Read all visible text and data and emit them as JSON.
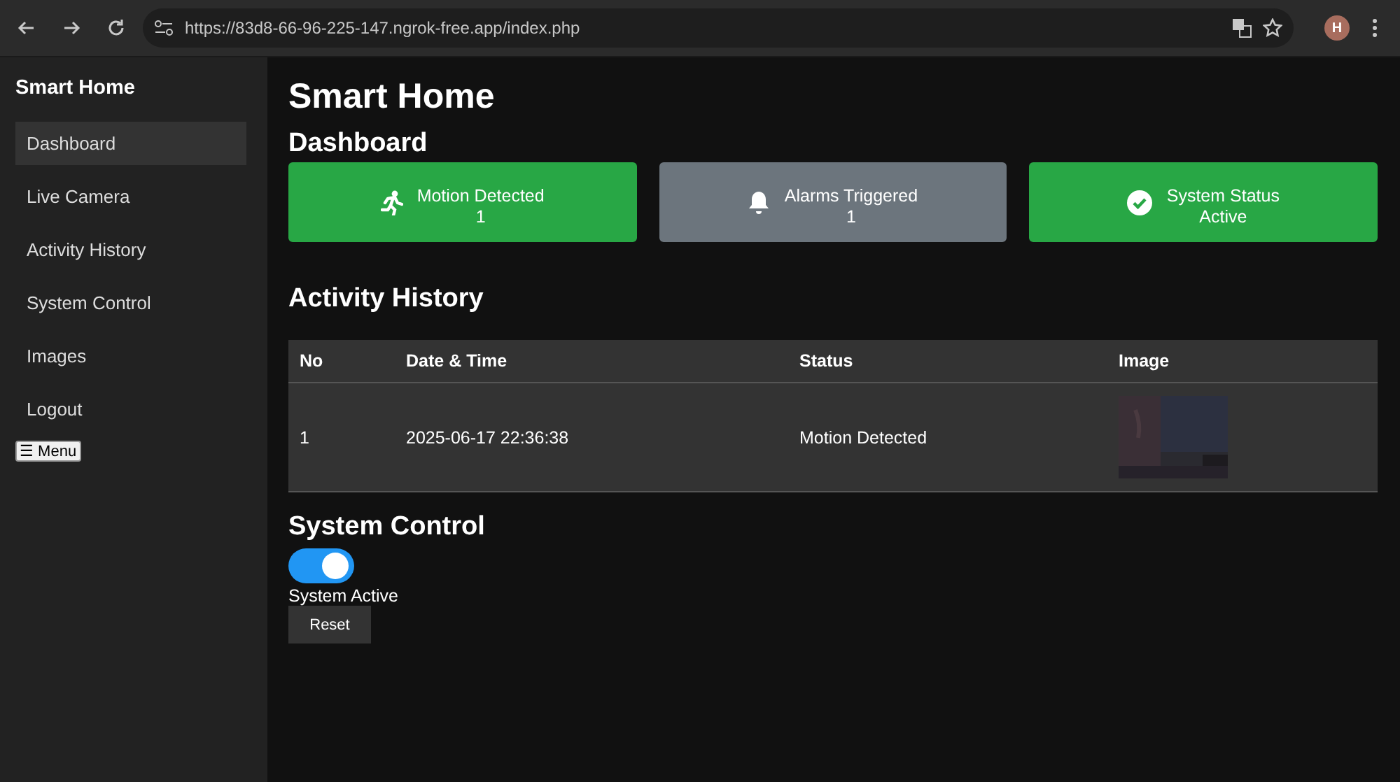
{
  "browser": {
    "url": "https://83d8-66-96-225-147.ngrok-free.app/index.php",
    "profile_initial": "H"
  },
  "sidebar": {
    "title": "Smart Home",
    "items": [
      {
        "label": "Dashboard",
        "selected": true
      },
      {
        "label": "Live Camera",
        "selected": false
      },
      {
        "label": "Activity History",
        "selected": false
      },
      {
        "label": "System Control",
        "selected": false
      },
      {
        "label": "Images",
        "selected": false
      },
      {
        "label": "Logout",
        "selected": false
      }
    ],
    "menu_button": "☰ Menu"
  },
  "page_title": "Smart Home",
  "dashboard": {
    "heading": "Dashboard",
    "cards": [
      {
        "kind": "motion",
        "label": "Motion Detected",
        "value": "1",
        "color": "#28a745"
      },
      {
        "kind": "alarm",
        "label": "Alarms Triggered",
        "value": "1",
        "color": "#6c757d"
      },
      {
        "kind": "status",
        "label": "System Status",
        "value": "Active",
        "color": "#28a745"
      }
    ]
  },
  "activity_history": {
    "heading": "Activity History",
    "table": {
      "columns": [
        "No",
        "Date & Time",
        "Status",
        "Image"
      ],
      "rows": [
        {
          "no": "1",
          "date_time": "2025-06-17 22:36:38",
          "status": "Motion Detected"
        }
      ]
    }
  },
  "system_control": {
    "heading": "System Control",
    "toggle": {
      "on": true
    },
    "status_label": "System Active",
    "reset_button": "Reset"
  }
}
